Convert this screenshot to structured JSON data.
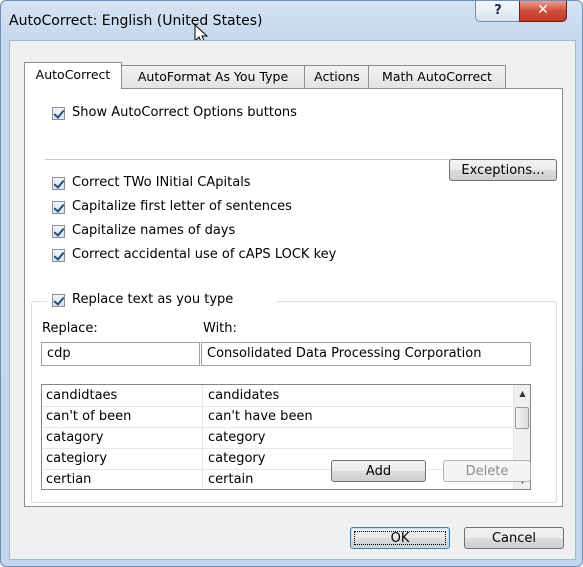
{
  "window": {
    "title": "AutoCorrect: English (United States)",
    "help_label": "?",
    "close_label": "✕"
  },
  "tabs": [
    {
      "label": "AutoCorrect"
    },
    {
      "label": "AutoFormat As You Type"
    },
    {
      "label": "Actions"
    },
    {
      "label": "Math AutoCorrect"
    }
  ],
  "options": {
    "show_buttons": "Show AutoCorrect Options buttons",
    "two_initial": "Correct TWo INitial CApitals",
    "first_letter": "Capitalize first letter of sentences",
    "names_of_days": "Capitalize names of days",
    "caps_lock": "Correct accidental use of cAPS LOCK key",
    "replace_text": "Replace text as you type"
  },
  "exceptions_label": "Exceptions...",
  "replace": {
    "replace_header": "Replace:",
    "with_header": "With:",
    "replace_value": "cdp",
    "with_value": "Consolidated Data Processing Corporation"
  },
  "list": {
    "rows": [
      {
        "replace": "candidtaes",
        "with": "candidates"
      },
      {
        "replace": "can't of been",
        "with": "can't have been"
      },
      {
        "replace": "catagory",
        "with": "category"
      },
      {
        "replace": "categiory",
        "with": "category"
      },
      {
        "replace": "certian",
        "with": "certain"
      }
    ],
    "scroll_up": "▲",
    "scroll_down": "▼"
  },
  "buttons": {
    "add": "Add",
    "delete": "Delete",
    "ok": "OK",
    "cancel": "Cancel"
  }
}
